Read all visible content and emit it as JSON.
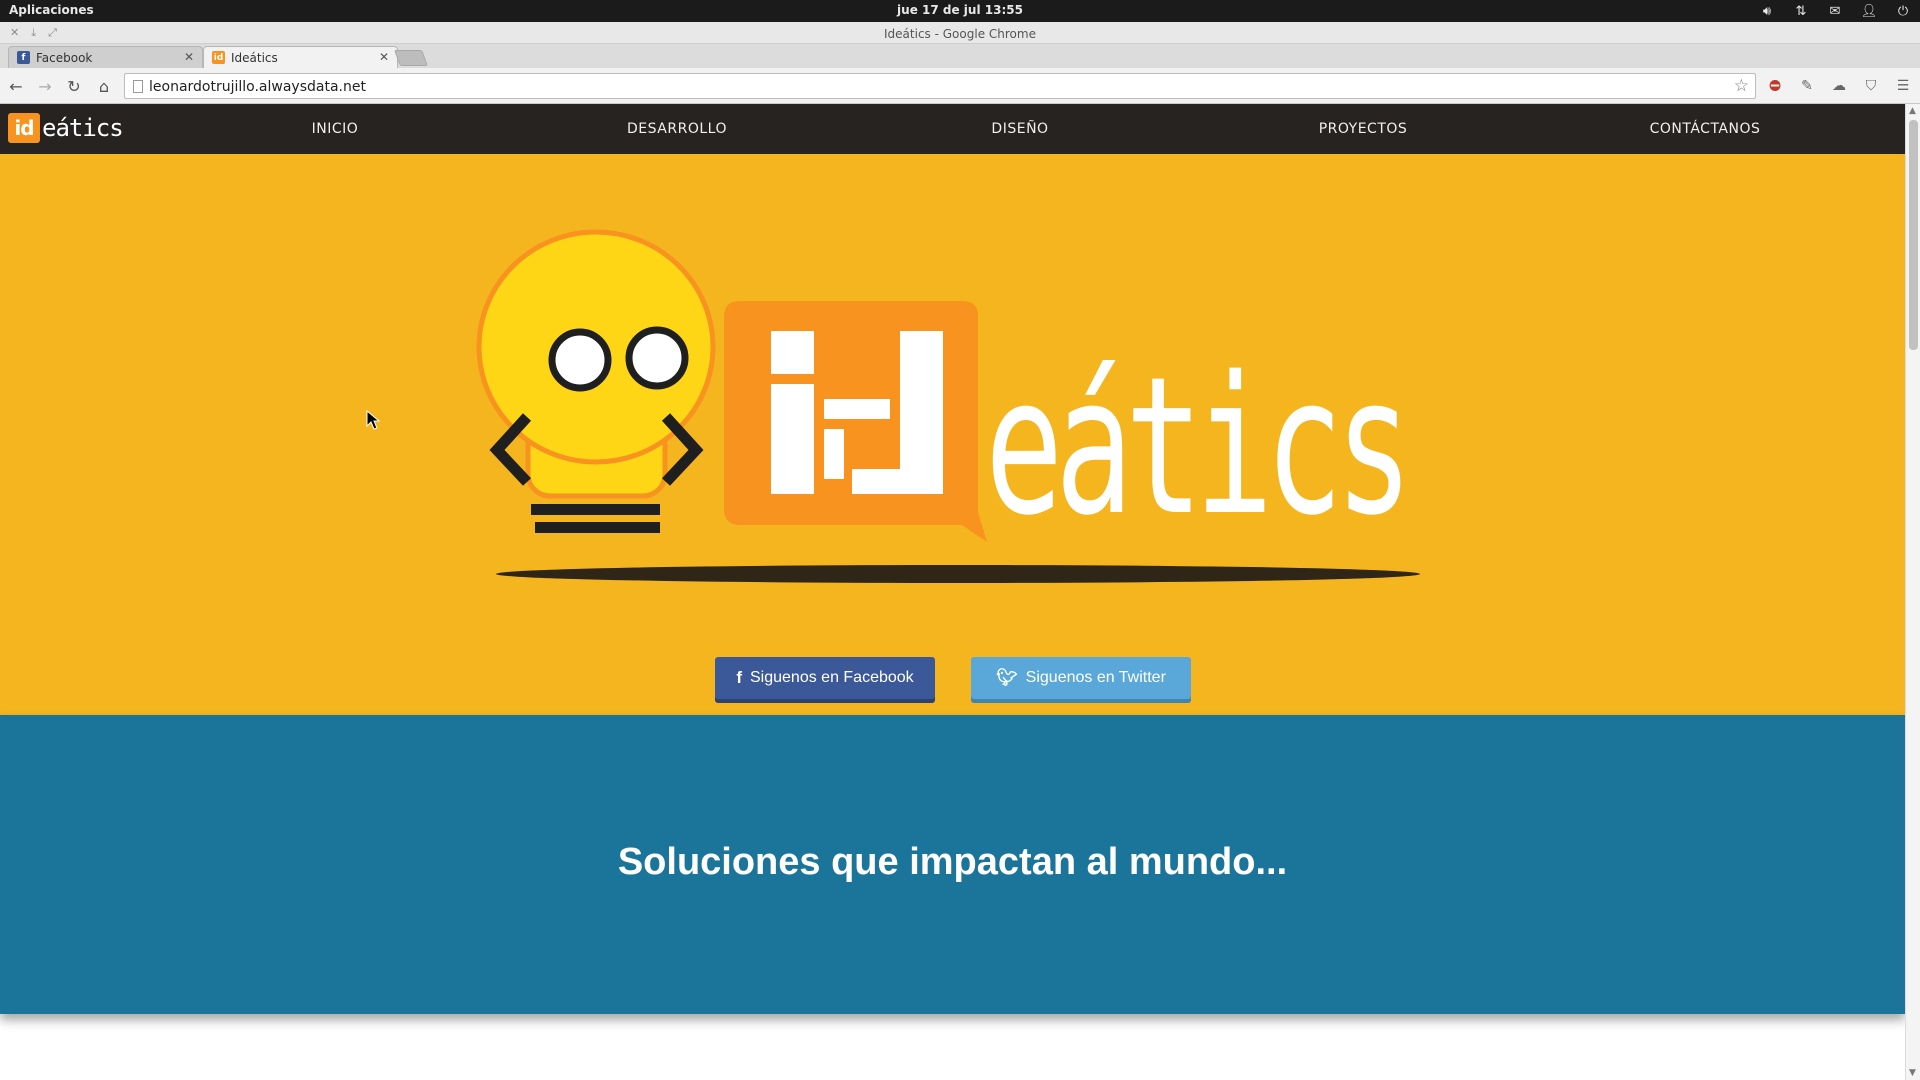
{
  "os_panel": {
    "apps_label": "Aplicaciones",
    "clock": "jue 17 de jul 13:55",
    "tray_icons": [
      "volume-icon",
      "network-icon",
      "mail-icon",
      "user-icon",
      "power-icon"
    ]
  },
  "window": {
    "title": "Ideátics - Google Chrome"
  },
  "tabs": [
    {
      "label": "Facebook",
      "favicon": "facebook-icon",
      "active": false
    },
    {
      "label": "Ideátics",
      "favicon": "ideatics-icon",
      "active": true
    }
  ],
  "toolbar": {
    "url": "leonardotrujillo.alwaysdata.net",
    "extensions": [
      "adblock-icon",
      "eyedropper-icon",
      "cloud-icon",
      "pocket-icon",
      "menu-icon"
    ]
  },
  "site": {
    "logo_box": "id",
    "logo_text": "eátics",
    "nav": [
      "INICIO",
      "DESARROLLO",
      "DISEÑO",
      "PROYECTOS",
      "CONTÁCTANOS"
    ],
    "hero_wordmark": "eátics",
    "buttons": {
      "facebook": "Siguenos en Facebook",
      "twitter": "Siguenos en Twitter"
    },
    "tagline": "Soluciones que impactan al mundo..."
  },
  "colors": {
    "hero_bg": "#f5b51e",
    "nav_bg": "#262320",
    "band_bg": "#1b759b",
    "brand_orange": "#f7931e",
    "facebook_blue": "#3b5998",
    "twitter_blue": "#5aa8d9"
  }
}
